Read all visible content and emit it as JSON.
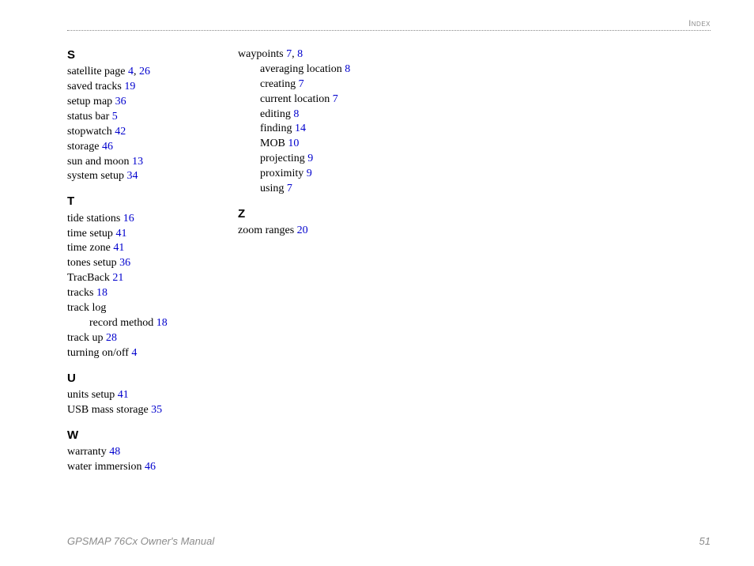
{
  "header": {
    "label": "Index"
  },
  "footer": {
    "left": "GPSMAP 76Cx Owner's Manual",
    "right": "51"
  },
  "columns": [
    {
      "sections": [
        {
          "letter": "S",
          "entries": [
            {
              "term": "satellite page",
              "pages": [
                "4",
                "26"
              ]
            },
            {
              "term": "saved tracks",
              "pages": [
                "19"
              ]
            },
            {
              "term": "setup map",
              "pages": [
                "36"
              ]
            },
            {
              "term": "status bar",
              "pages": [
                "5"
              ]
            },
            {
              "term": "stopwatch",
              "pages": [
                "42"
              ]
            },
            {
              "term": "storage",
              "pages": [
                "46"
              ]
            },
            {
              "term": "sun and moon",
              "pages": [
                "13"
              ]
            },
            {
              "term": "system setup",
              "pages": [
                "34"
              ]
            }
          ]
        },
        {
          "letter": "T",
          "entries": [
            {
              "term": "tide stations",
              "pages": [
                "16"
              ]
            },
            {
              "term": "time setup",
              "pages": [
                "41"
              ]
            },
            {
              "term": "time zone",
              "pages": [
                "41"
              ]
            },
            {
              "term": "tones setup",
              "pages": [
                "36"
              ]
            },
            {
              "term": "TracBack",
              "pages": [
                "21"
              ]
            },
            {
              "term": "tracks",
              "pages": [
                "18"
              ]
            },
            {
              "term": "track log",
              "pages": []
            },
            {
              "term": "record method",
              "pages": [
                "18"
              ],
              "sub": true
            },
            {
              "term": "track up",
              "pages": [
                "28"
              ]
            },
            {
              "term": "turning on/off",
              "pages": [
                "4"
              ]
            }
          ]
        },
        {
          "letter": "U",
          "entries": [
            {
              "term": "units setup",
              "pages": [
                "41"
              ]
            },
            {
              "term": "USB mass storage",
              "pages": [
                "35"
              ]
            }
          ]
        },
        {
          "letter": "W",
          "entries": [
            {
              "term": "warranty",
              "pages": [
                "48"
              ]
            },
            {
              "term": "water immersion",
              "pages": [
                "46"
              ]
            }
          ]
        }
      ]
    },
    {
      "sections": [
        {
          "letter": "",
          "entries": [
            {
              "term": "waypoints",
              "pages": [
                "7",
                "8"
              ]
            },
            {
              "term": "averaging location",
              "pages": [
                "8"
              ],
              "sub": true
            },
            {
              "term": "creating",
              "pages": [
                "7"
              ],
              "sub": true
            },
            {
              "term": "current location",
              "pages": [
                "7"
              ],
              "sub": true
            },
            {
              "term": "editing",
              "pages": [
                "8"
              ],
              "sub": true
            },
            {
              "term": "finding",
              "pages": [
                "14"
              ],
              "sub": true
            },
            {
              "term": "MOB",
              "pages": [
                "10"
              ],
              "sub": true
            },
            {
              "term": "projecting",
              "pages": [
                "9"
              ],
              "sub": true
            },
            {
              "term": "proximity",
              "pages": [
                "9"
              ],
              "sub": true
            },
            {
              "term": "using",
              "pages": [
                "7"
              ],
              "sub": true
            }
          ]
        },
        {
          "letter": "Z",
          "entries": [
            {
              "term": "zoom ranges",
              "pages": [
                "20"
              ]
            }
          ]
        }
      ]
    }
  ]
}
